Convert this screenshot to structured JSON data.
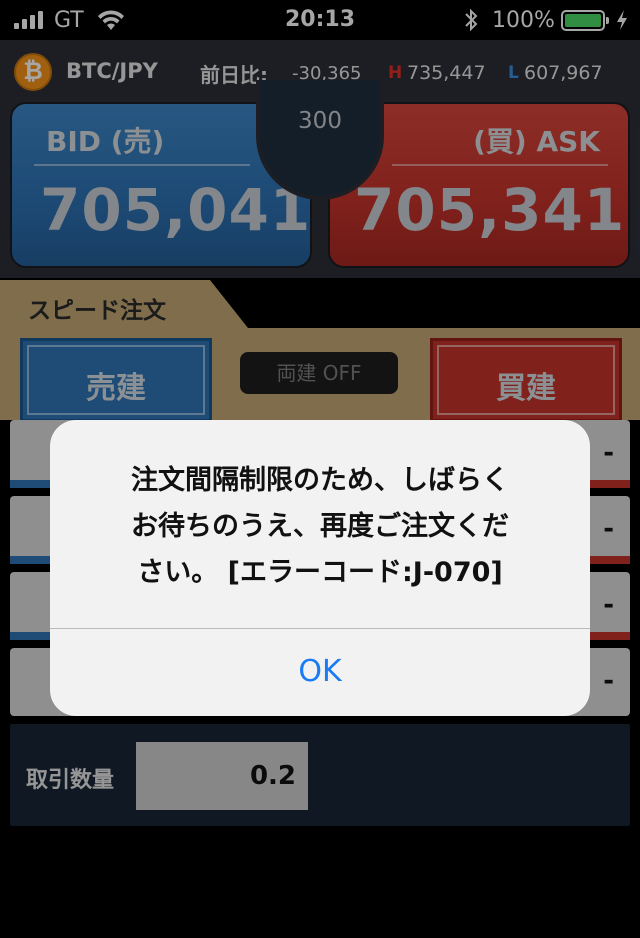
{
  "status_bar": {
    "carrier": "GT",
    "time": "20:13",
    "battery_percent": "100%",
    "signal_icon": "signal-bars-icon",
    "wifi_icon": "wifi-icon",
    "bluetooth_icon": "bluetooth-icon",
    "battery_icon": "battery-icon",
    "charging_icon": "charging-bolt-icon"
  },
  "header": {
    "coin_glyph": "₿",
    "pair": "BTC/JPY",
    "change_label": "前日比:",
    "change_value": "-30,365",
    "high_mark": "H",
    "high_value": "735,447",
    "low_mark": "L",
    "low_value": "607,967"
  },
  "quote": {
    "bid_label": "BID (売)",
    "bid_price": "705,041",
    "ask_label": "(買) ASK",
    "ask_price": "705,341",
    "spread": "300"
  },
  "speed_order": {
    "tab_label": "スピード注文",
    "sell_label": "売建",
    "buy_label": "買建",
    "toggle_label": "両建 OFF"
  },
  "rows": [
    {
      "value": "-"
    },
    {
      "value": "-"
    },
    {
      "value": "-"
    },
    {
      "value": "-"
    }
  ],
  "quantity": {
    "label": "取引数量",
    "value": "0.2"
  },
  "alert": {
    "line1": "注文間隔制限のため、しばらく",
    "line2": "お待ちのうえ、再度ご注文くだ",
    "line3": "さい。 [エラーコード:J-070]",
    "ok_label": "OK"
  },
  "colors": {
    "bid_blue": "#2c72b4",
    "ask_red": "#c6332b",
    "gold": "#c3a873",
    "link_blue": "#1a7cf5",
    "battery_green": "#4cd964"
  }
}
